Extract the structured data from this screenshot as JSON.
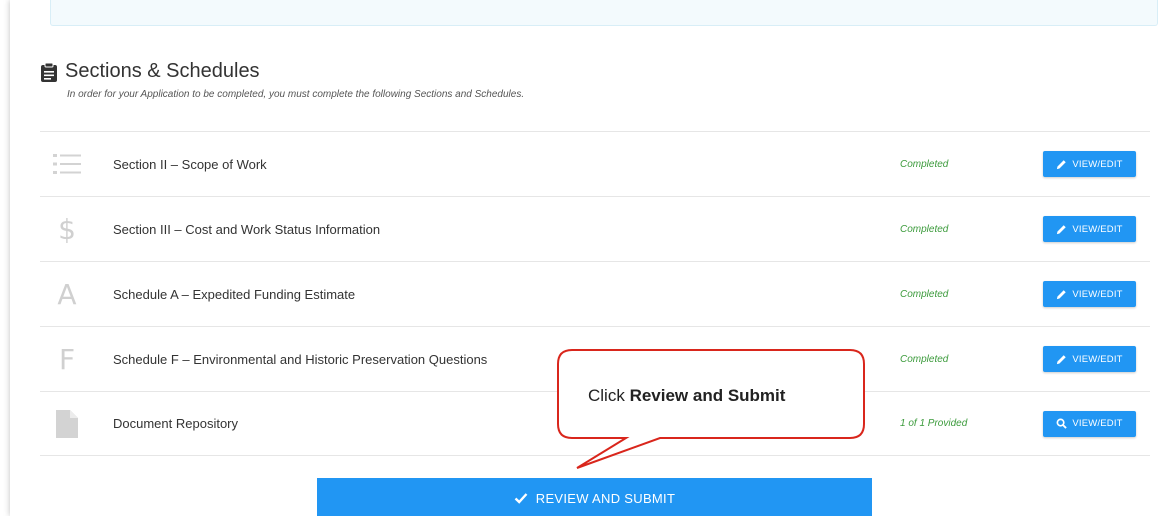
{
  "section": {
    "title": "Sections & Schedules",
    "subtitle": "In order for your Application to be completed, you must complete the following Sections and Schedules."
  },
  "rows": [
    {
      "icon": "list-icon",
      "label": "Section II – Scope of Work",
      "status": "Completed",
      "button": "VIEW/EDIT",
      "button_icon": "pencil-icon"
    },
    {
      "icon": "dollar-icon",
      "glyph": "$",
      "label": "Section III – Cost and Work Status Information",
      "status": "Completed",
      "button": "VIEW/EDIT",
      "button_icon": "pencil-icon"
    },
    {
      "icon": "letter-a-icon",
      "glyph": "A",
      "label": "Schedule A – Expedited Funding Estimate",
      "status": "Completed",
      "button": "VIEW/EDIT",
      "button_icon": "pencil-icon"
    },
    {
      "icon": "letter-f-icon",
      "glyph": "F",
      "label": "Schedule F – Environmental and Historic Preservation Questions",
      "status": "Completed",
      "button": "VIEW/EDIT",
      "button_icon": "pencil-icon"
    },
    {
      "icon": "document-icon",
      "label": "Document Repository",
      "status": "1 of 1 Provided",
      "button": "VIEW/EDIT",
      "button_icon": "magnifier-icon"
    }
  ],
  "submit": {
    "label": "REVIEW AND SUBMIT",
    "icon": "checkmark-icon"
  },
  "callout": {
    "prefix": "Click ",
    "bold": "Review and Submit"
  },
  "colors": {
    "accent": "#2196f3",
    "status_green": "#3c9b3c",
    "callout_border": "#d9261c"
  }
}
